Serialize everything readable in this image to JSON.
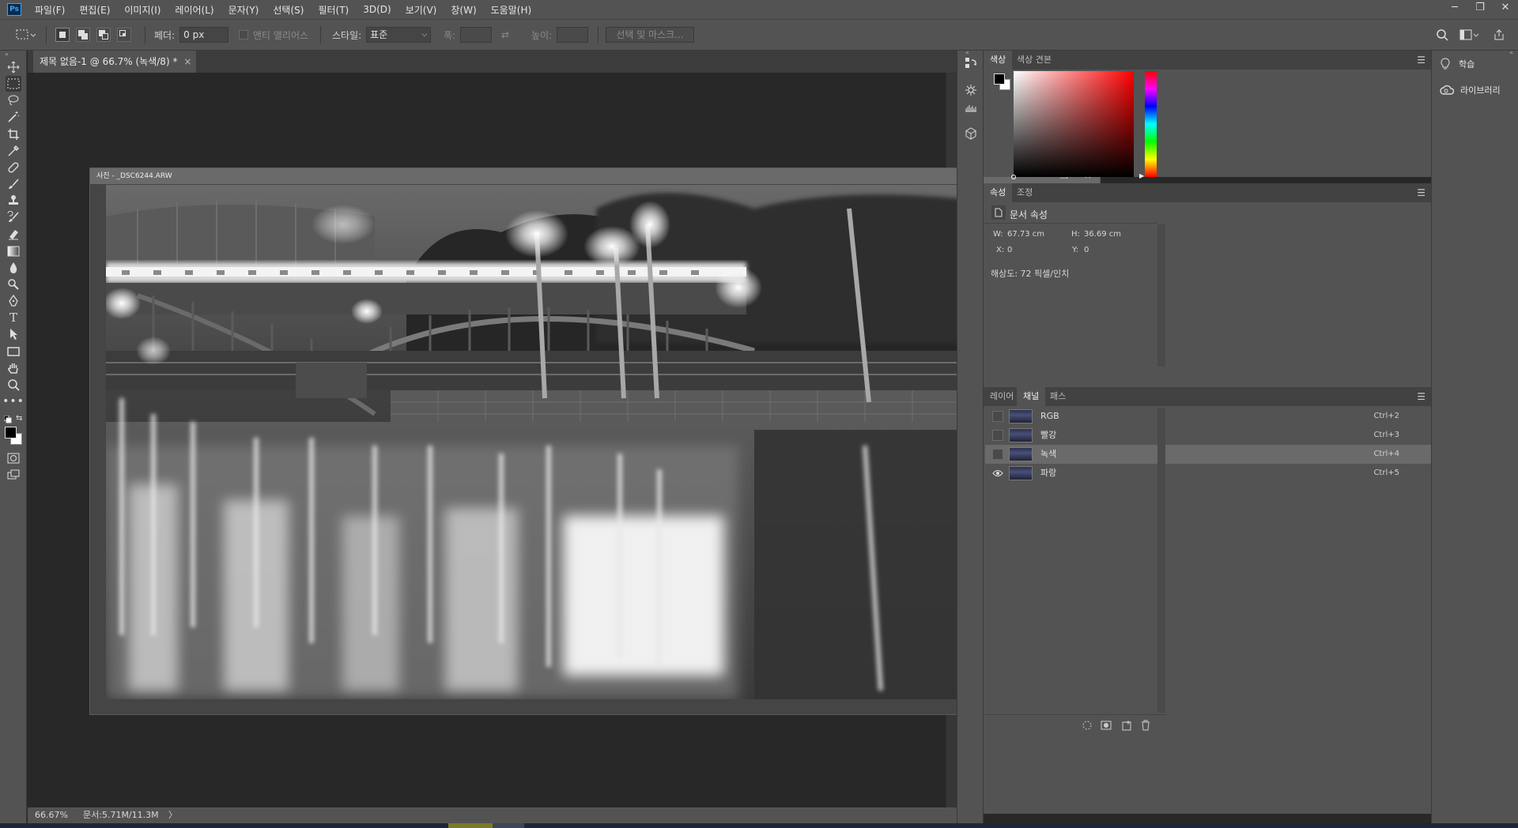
{
  "app": {
    "logo": "Ps"
  },
  "menu": [
    "파일(F)",
    "편집(E)",
    "이미지(I)",
    "레이어(L)",
    "문자(Y)",
    "선택(S)",
    "필터(T)",
    "3D(D)",
    "보기(V)",
    "창(W)",
    "도움말(H)"
  ],
  "window_controls": {
    "minimize": "─",
    "restore": "❐",
    "close": "✕"
  },
  "options": {
    "feather_label": "페더:",
    "feather_value": "0 px",
    "antialias_label": "앤티 앨리어스",
    "style_label": "스타일:",
    "style_value": "표준",
    "width_label": "폭:",
    "height_label": "높이:",
    "mask_button": "선택 및 마스크..."
  },
  "document": {
    "tab_title": "제목 없음-1 @ 66.7% (녹색/8) *",
    "close": "×",
    "zoom": "66.67%",
    "doc_info": "문서:5.71M/11.3M",
    "status_arrow": "〉"
  },
  "photo_window": {
    "title": "사진 - _DSC6244.ARW",
    "minimize": "─",
    "restore": "❐",
    "close": "✕"
  },
  "color_panel": {
    "tabs": [
      "색상",
      "색상 견본"
    ],
    "foreground": "#000000",
    "background": "#ffffff",
    "hue_color": "#ff0000"
  },
  "properties_panel": {
    "tabs": [
      "속성",
      "조정"
    ],
    "section_title": "문서 속성",
    "w_label": "W:",
    "w_value": "67.73 cm",
    "h_label": "H:",
    "h_value": "36.69 cm",
    "x_label": "X:",
    "x_value": "0",
    "y_label": "Y:",
    "y_value": "0",
    "resolution": "해상도: 72 픽셀/인치"
  },
  "channels_panel": {
    "tabs": [
      "레이어",
      "채널",
      "패스"
    ],
    "active_tab": "채널",
    "rows": [
      {
        "name": "RGB",
        "shortcut": "Ctrl+2",
        "visible": false,
        "selected": false
      },
      {
        "name": "빨강",
        "shortcut": "Ctrl+3",
        "visible": false,
        "selected": false
      },
      {
        "name": "녹색",
        "shortcut": "Ctrl+4",
        "visible": false,
        "selected": true
      },
      {
        "name": "파랑",
        "shortcut": "Ctrl+5",
        "visible": true,
        "selected": false
      }
    ]
  },
  "learn_panel": {
    "items": [
      "학습",
      "라이브러리"
    ]
  }
}
